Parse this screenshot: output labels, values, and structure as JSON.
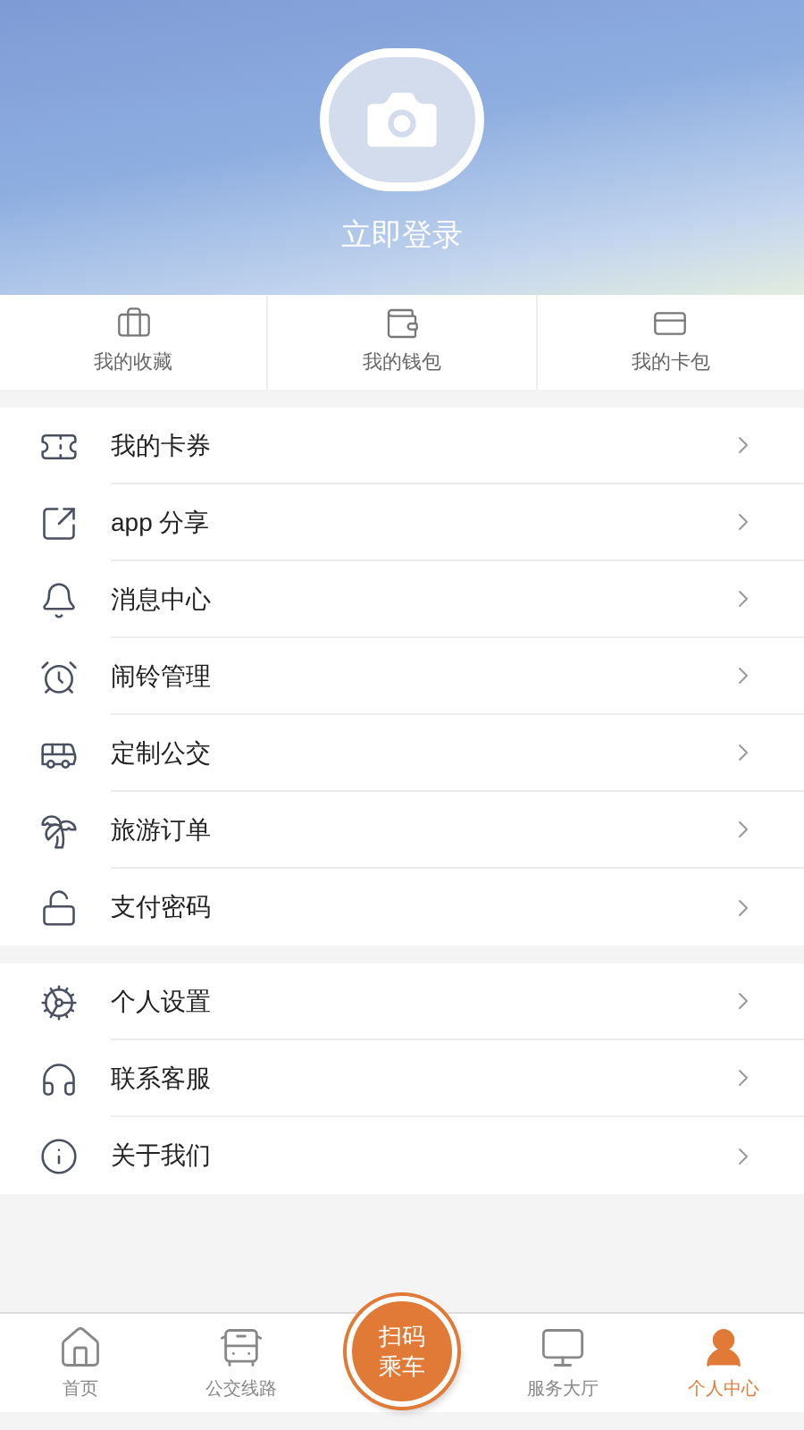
{
  "profile": {
    "login_label": "立即登录"
  },
  "shortcuts": [
    {
      "label": "我的收藏"
    },
    {
      "label": "我的钱包"
    },
    {
      "label": "我的卡包"
    }
  ],
  "menu_groups": [
    {
      "items": [
        {
          "label": "我的卡券"
        },
        {
          "label": "app 分享"
        },
        {
          "label": "消息中心"
        },
        {
          "label": "闹铃管理"
        },
        {
          "label": "定制公交"
        },
        {
          "label": "旅游订单"
        },
        {
          "label": "支付密码"
        }
      ]
    },
    {
      "items": [
        {
          "label": "个人设置"
        },
        {
          "label": "联系客服"
        },
        {
          "label": "关于我们"
        }
      ]
    }
  ],
  "tab_bar": [
    {
      "kind": "tab",
      "label": "首页",
      "selected": false
    },
    {
      "kind": "tab",
      "label": "公交线路",
      "selected": false
    },
    {
      "kind": "scan",
      "lines": [
        "扫码",
        "乘车"
      ]
    },
    {
      "kind": "tab",
      "label": "服务大厅",
      "selected": false
    },
    {
      "kind": "tab",
      "label": "个人中心",
      "selected": true
    }
  ]
}
